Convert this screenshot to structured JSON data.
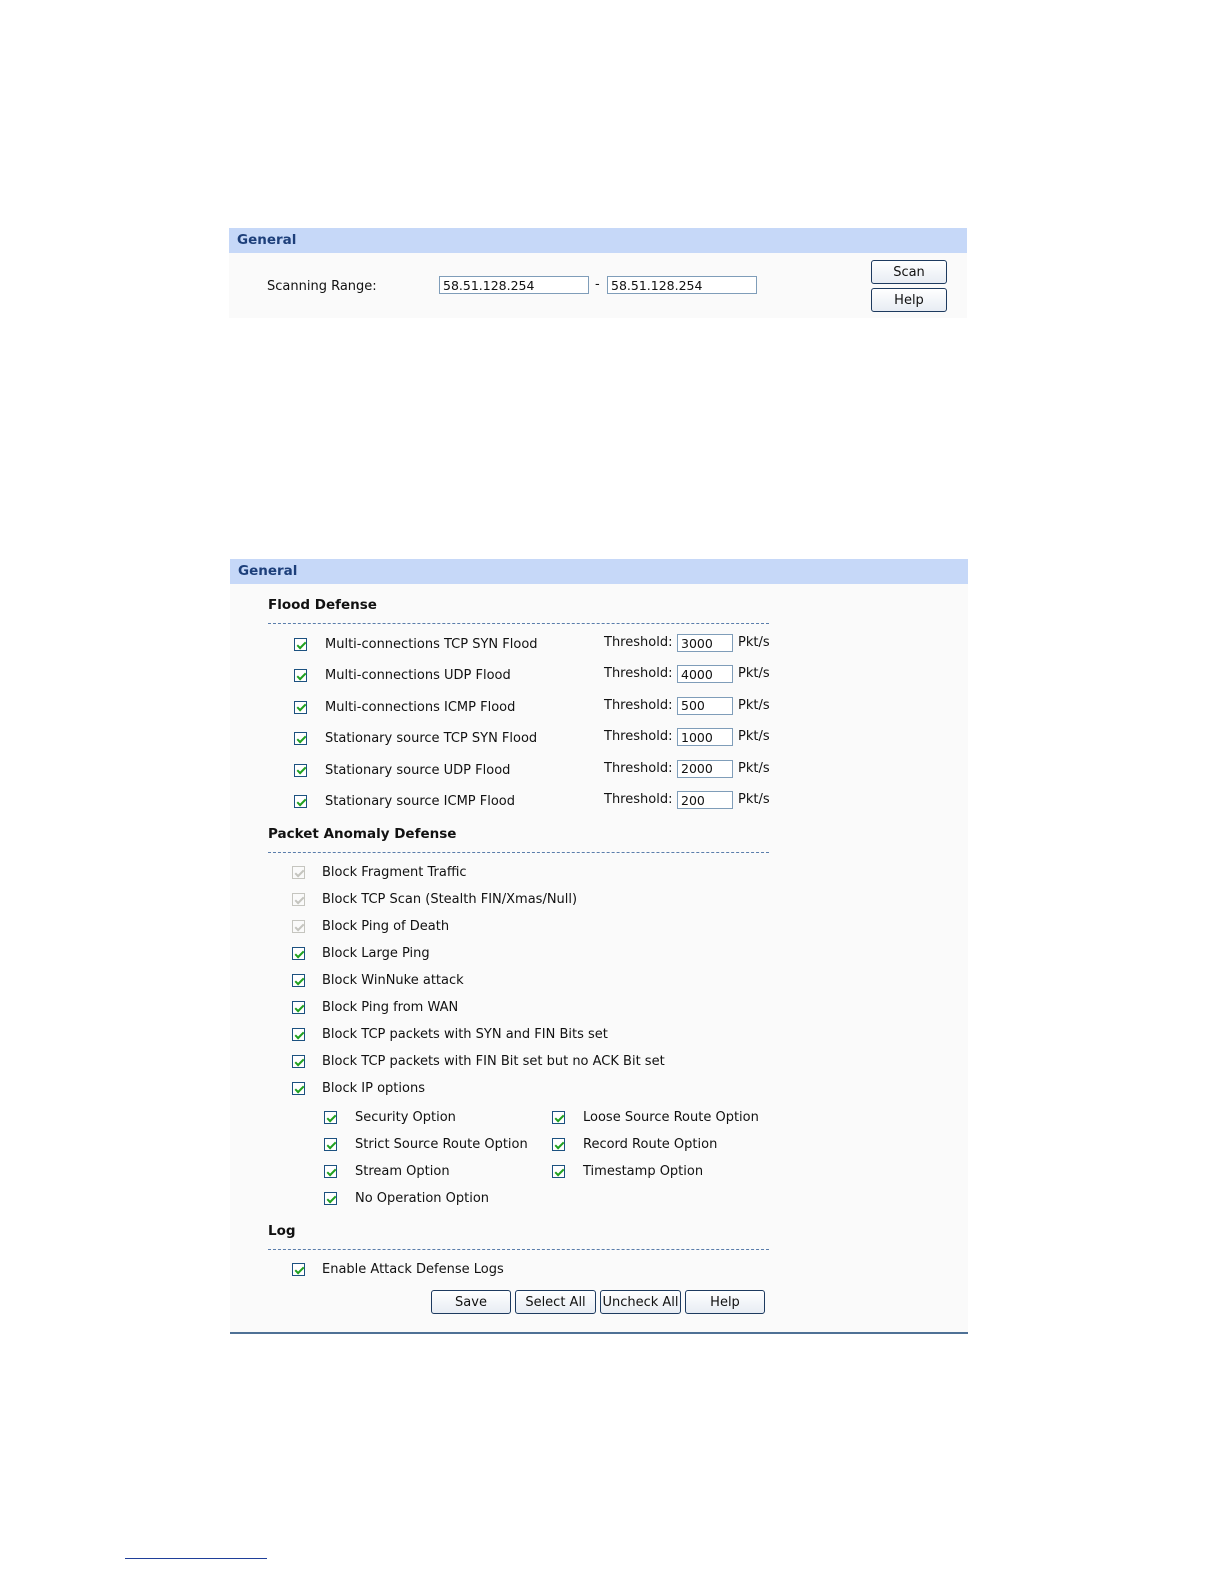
{
  "scan_panel": {
    "title": "General",
    "range_label": "Scanning Range:",
    "range_start": "58.51.128.254",
    "separator": "-",
    "range_end": "58.51.128.254",
    "scan_button": "Scan",
    "help_button": "Help"
  },
  "defense_panel": {
    "title": "General",
    "flood": {
      "title": "Flood Defense",
      "threshold_label": "Threshold:",
      "unit": "Pkt/s",
      "items": [
        {
          "label": "Multi-connections TCP SYN Flood",
          "checked": true,
          "threshold": "3000"
        },
        {
          "label": "Multi-connections UDP Flood",
          "checked": true,
          "threshold": "4000"
        },
        {
          "label": "Multi-connections ICMP Flood",
          "checked": true,
          "threshold": "500"
        },
        {
          "label": "Stationary source TCP SYN Flood",
          "checked": true,
          "threshold": "1000"
        },
        {
          "label": "Stationary source UDP Flood",
          "checked": true,
          "threshold": "2000"
        },
        {
          "label": "Stationary source ICMP Flood",
          "checked": true,
          "threshold": "200"
        }
      ]
    },
    "anomaly": {
      "title": "Packet Anomaly Defense",
      "items": [
        {
          "label": "Block Fragment Traffic",
          "checked": true,
          "disabled": true
        },
        {
          "label": "Block TCP Scan (Stealth FIN/Xmas/Null)",
          "checked": true,
          "disabled": true
        },
        {
          "label": "Block Ping of Death",
          "checked": true,
          "disabled": true
        },
        {
          "label": "Block Large Ping",
          "checked": true,
          "disabled": false
        },
        {
          "label": "Block WinNuke attack",
          "checked": true,
          "disabled": false
        },
        {
          "label": "Block Ping from WAN",
          "checked": true,
          "disabled": false
        },
        {
          "label": "Block TCP packets with SYN and FIN Bits set",
          "checked": true,
          "disabled": false
        },
        {
          "label": "Block TCP packets with FIN Bit set but no ACK Bit set",
          "checked": true,
          "disabled": false
        },
        {
          "label": "Block IP options",
          "checked": true,
          "disabled": false
        }
      ],
      "ip_options": [
        {
          "label": "Security Option",
          "checked": true
        },
        {
          "label": "Loose Source Route Option",
          "checked": true
        },
        {
          "label": "Strict Source Route Option",
          "checked": true
        },
        {
          "label": "Record Route Option",
          "checked": true
        },
        {
          "label": "Stream Option",
          "checked": true
        },
        {
          "label": "Timestamp Option",
          "checked": true
        },
        {
          "label": "No Operation Option",
          "checked": true
        }
      ]
    },
    "log": {
      "title": "Log",
      "enable_label": "Enable Attack Defense Logs",
      "enable_checked": true
    },
    "buttons": {
      "save": "Save",
      "select_all": "Select All",
      "uncheck_all": "Uncheck All",
      "help": "Help"
    }
  }
}
